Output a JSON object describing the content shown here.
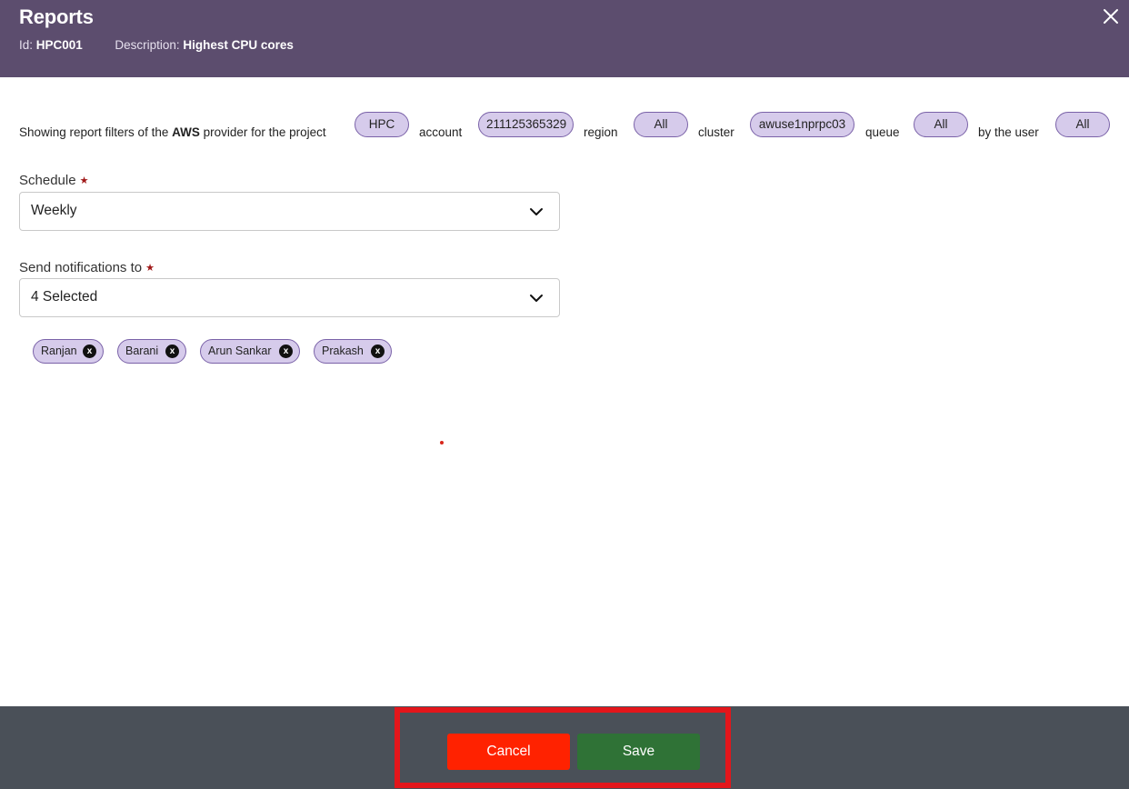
{
  "header": {
    "title": "Reports",
    "id_label": "Id:",
    "id_value": "HPC001",
    "description_label": "Description:",
    "description_value": "Highest CPU cores"
  },
  "filters": {
    "lead_text_1": "Showing report filters of the ",
    "provider": "AWS",
    "lead_text_2": " provider for the project",
    "project": "HPC",
    "account_label": "account",
    "account": "211125365329",
    "region_label": "region",
    "region": "All",
    "cluster_label": "cluster",
    "cluster": "awuse1nprpc03",
    "queue_label": "queue",
    "queue": "All",
    "user_label": "by the user",
    "user": "All"
  },
  "schedule": {
    "label": "Schedule",
    "required_mark": "★",
    "value": "Weekly"
  },
  "notifications": {
    "label": "Send notifications to",
    "required_mark": "★",
    "value": "4 Selected",
    "recipients": [
      "Ranjan",
      "Barani",
      "Arun Sankar",
      "Prakash"
    ],
    "remove_glyph": "x"
  },
  "footer": {
    "cancel_label": "Cancel",
    "save_label": "Save"
  },
  "colors": {
    "header_bg": "#5c4d6e",
    "pill_bg": "#d6cbeb",
    "pill_border": "#7a62a8",
    "footer_bg": "#4a5058",
    "cancel": "#ff2200",
    "save": "#2f7236",
    "highlight": "#e3161b"
  }
}
